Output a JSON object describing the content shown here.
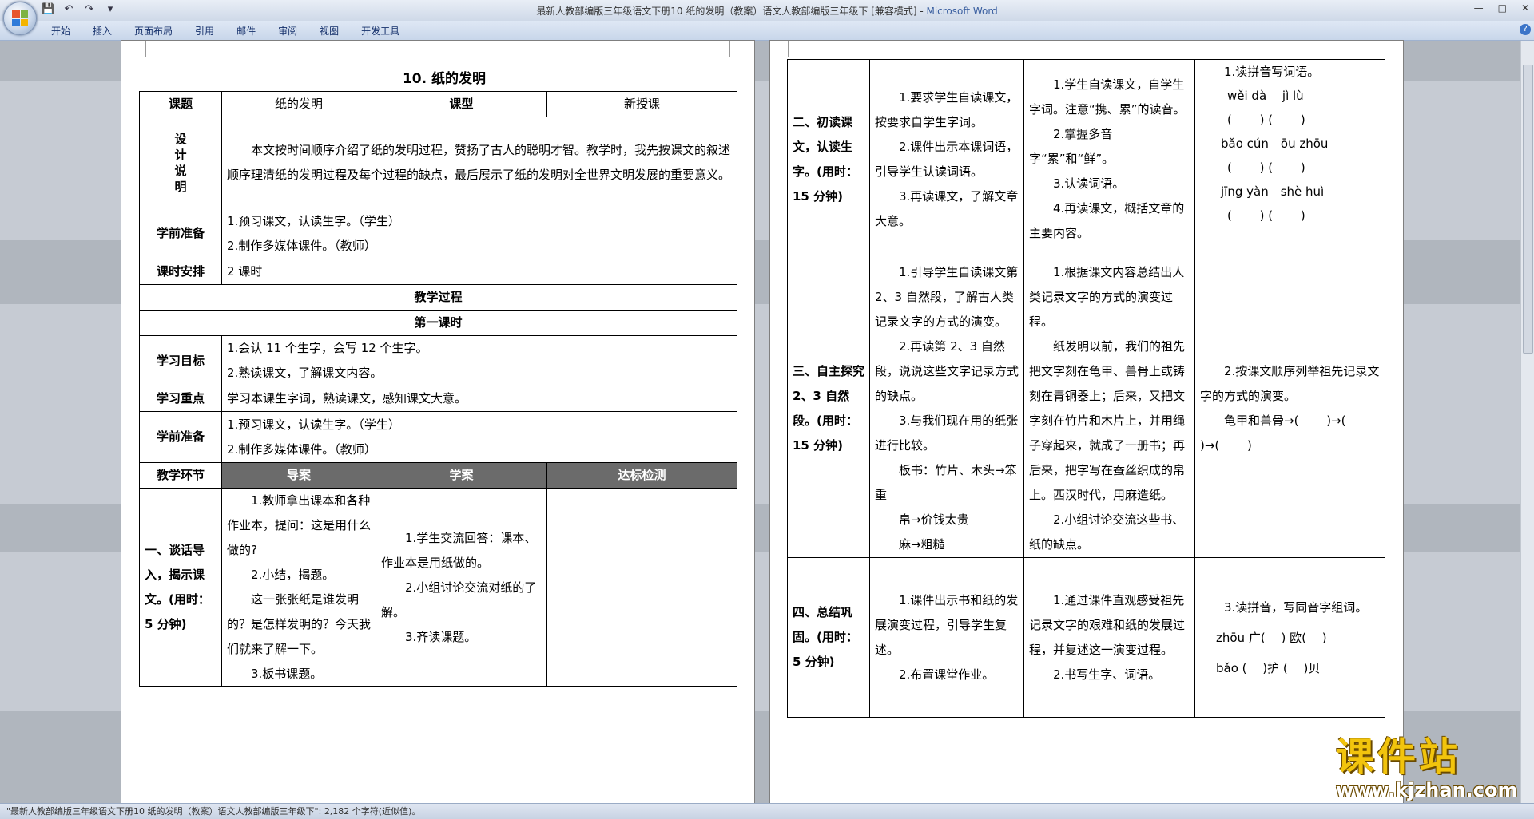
{
  "window": {
    "title": "最新人教部编版三年级语文下册10 纸的发明（教案）语文人教部编版三年级下 [兼容模式] - ",
    "app_name": "Microsoft Word"
  },
  "ribbon_tabs": [
    "开始",
    "插入",
    "页面布局",
    "引用",
    "邮件",
    "审阅",
    "视图",
    "开发工具"
  ],
  "help_label": "?",
  "page1": {
    "doc_title": "10. 纸的发明",
    "rows": {
      "keti_label": "课题",
      "keti_value": "纸的发明",
      "kexing_label": "课型",
      "kexing_value": "新授课",
      "sheji_label": "设计说明",
      "sheji_text": "本文按时间顺序介绍了纸的发明过程，赞扬了古人的聪明才智。教学时，我先按课文的叙述顺序理清纸的发明过程及每个过程的缺点，最后展示了纸的发明对全世界文明发展的重要意义。",
      "zhunbei_label": "学前准备",
      "zhunbei_1": "1.预习课文，认读生字。（学生）",
      "zhunbei_2": "2.制作多媒体课件。（教师）",
      "keshi_label": "课时安排",
      "keshi_value": "2 课时",
      "guocheng": "教学过程",
      "diyi": "第一课时",
      "mubiao_label": "学习目标",
      "mubiao_1": "1.会认 11 个生字，会写 12 个生字。",
      "mubiao_2": "2.熟读课文，了解课文内容。",
      "zhongdian_label": "学习重点",
      "zhongdian_value": "学习本课生字词，熟读课文，感知课文大意。",
      "zhunbei2_label": "学前准备",
      "zhunbei2_1": "1.预习课文，认读生字。（学生）",
      "zhunbei2_2": "2.制作多媒体课件。（教师）",
      "huanjie_label": "教学环节",
      "col_daoan": "导案",
      "col_xuean": "学案",
      "col_dabiao": "达标检测",
      "s1_label": "一、谈话导入，揭示课文。(用时：5 分钟)",
      "s1_daoan": [
        "1.教师拿出课本和各种作业本，提问：这是用什么做的?",
        "2.小结，揭题。",
        "这一张张纸是谁发明的？是怎样发明的？今天我们就来了解一下。",
        "3.板书课题。"
      ],
      "s1_xuean": [
        "1.学生交流回答：课本、作业本是用纸做的。",
        "2.小组讨论交流对纸的了解。",
        "3.齐读课题。"
      ]
    }
  },
  "page2": {
    "s2_label": "二、初读课文，认读生字。(用时：15 分钟)",
    "s2_daoan": [
      "1.要求学生自读课文，按要求自学生字词。",
      "2.课件出示本课词语，引导学生认读词语。",
      "3.再读课文，了解文章大意。"
    ],
    "s2_xuean": [
      "1.学生自读课文，自学生字词。注意“携、累”的读音。",
      "2.掌握多音字“累”和“鲜”。",
      "3.认读词语。",
      "4.再读课文，概括文章的主要内容。"
    ],
    "s2_dabiao": [
      "1.读拼音写词语。",
      "wěi dà　 jì lù",
      "(　　 ) (　　 )",
      "bǎo cún　ōu zhōu",
      "(　　 ) (　　 )",
      "jīng yàn　shè huì",
      "(　　 ) (　　 )"
    ],
    "s3_label": "三、自主探究2、3 自然段。(用时：15 分钟)",
    "s3_daoan": [
      "1.引导学生自读课文第 2、3 自然段，了解古人类记录文字的方式的演变。",
      "2.再读第 2、3 自然段，说说这些文字记录方式的缺点。",
      "3.与我们现在用的纸张进行比较。",
      "板书：竹片、木头→笨重",
      "帛→价钱太贵",
      "麻→粗糙"
    ],
    "s3_xuean": [
      "1.根据课文内容总结出人类记录文字的方式的演变过程。",
      "纸发明以前，我们的祖先把文字刻在龟甲、兽骨上或铸刻在青铜器上；后来，又把文字刻在竹片和木片上，并用绳子穿起来，就成了一册书；再后来，把字写在蚕丝织成的帛上。西汉时代，用麻造纸。",
      "2.小组讨论交流这些书、纸的缺点。"
    ],
    "s3_dabiao": [
      "2.按课文顺序列举祖先记录文字的方式的演变。",
      "龟甲和兽骨→(　　 )→(　　 )→(　　 )"
    ],
    "s4_label": "四、总结巩固。(用时：5 分钟)",
    "s4_daoan": [
      "1.课件出示书和纸的发展演变过程，引导学生复述。",
      "2.布置课堂作业。"
    ],
    "s4_xuean": [
      "1.通过课件直观感受祖先记录文字的艰难和纸的发展过程，并复述这一演变过程。",
      "2.书写生字、词语。"
    ],
    "s4_dabiao": [
      "3.读拼音，写同音字组词。",
      "zhōu 广(　 ) 欧(　 )",
      "bǎo (　 )护 (　 )贝"
    ]
  },
  "statusbar": {
    "text": "\"最新人教部编版三年级语文下册10 纸的发明（教案）语文人教部编版三年级下\": 2,182 个字符(近似值)。"
  },
  "watermark": {
    "brand": "课件站",
    "url": "www.kjzhan.com"
  }
}
